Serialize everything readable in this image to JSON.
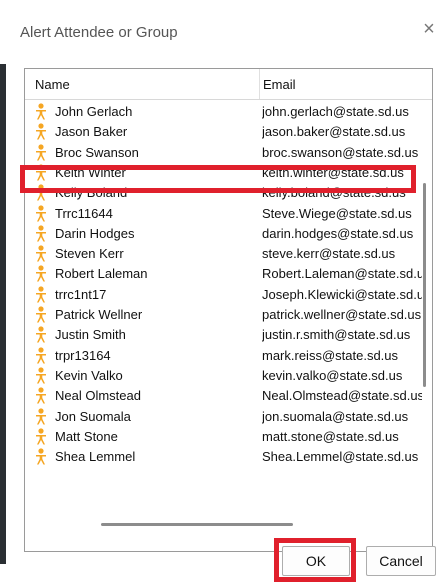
{
  "dialog": {
    "title": "Alert Attendee or Group",
    "close_glyph": "×"
  },
  "table": {
    "columns": [
      "Name",
      "Email"
    ],
    "rows": [
      {
        "name": "John Gerlach",
        "email": "john.gerlach@state.sd.us"
      },
      {
        "name": "Jason Baker",
        "email": "jason.baker@state.sd.us"
      },
      {
        "name": "Broc Swanson",
        "email": "broc.swanson@state.sd.us"
      },
      {
        "name": "Keith Winter",
        "email": "keith.winter@state.sd.us"
      },
      {
        "name": "Kelly Boland",
        "email": "kelly.boland@state.sd.us"
      },
      {
        "name": "Trrc11644",
        "email": "Steve.Wiege@state.sd.us"
      },
      {
        "name": "Darin Hodges",
        "email": "darin.hodges@state.sd.us"
      },
      {
        "name": "Steven Kerr",
        "email": "steve.kerr@state.sd.us"
      },
      {
        "name": "Robert Laleman",
        "email": "Robert.Laleman@state.sd.us"
      },
      {
        "name": "trrc1nt17",
        "email": "Joseph.Klewicki@state.sd.us"
      },
      {
        "name": "Patrick Wellner",
        "email": "patrick.wellner@state.sd.us"
      },
      {
        "name": "Justin Smith",
        "email": "justin.r.smith@state.sd.us"
      },
      {
        "name": "trpr13164",
        "email": "mark.reiss@state.sd.us"
      },
      {
        "name": "Kevin Valko",
        "email": "kevin.valko@state.sd.us"
      },
      {
        "name": "Neal Olmstead",
        "email": "Neal.Olmstead@state.sd.us"
      },
      {
        "name": "Jon Suomala",
        "email": "jon.suomala@state.sd.us"
      },
      {
        "name": "Matt Stone",
        "email": "matt.stone@state.sd.us"
      },
      {
        "name": "Shea Lemmel",
        "email": "Shea.Lemmel@state.sd.us"
      }
    ],
    "selected_index": 3
  },
  "buttons": {
    "ok": "OK",
    "cancel": "Cancel"
  },
  "colors": {
    "highlight": "#e0202c",
    "person_icon": "#f5a623"
  }
}
